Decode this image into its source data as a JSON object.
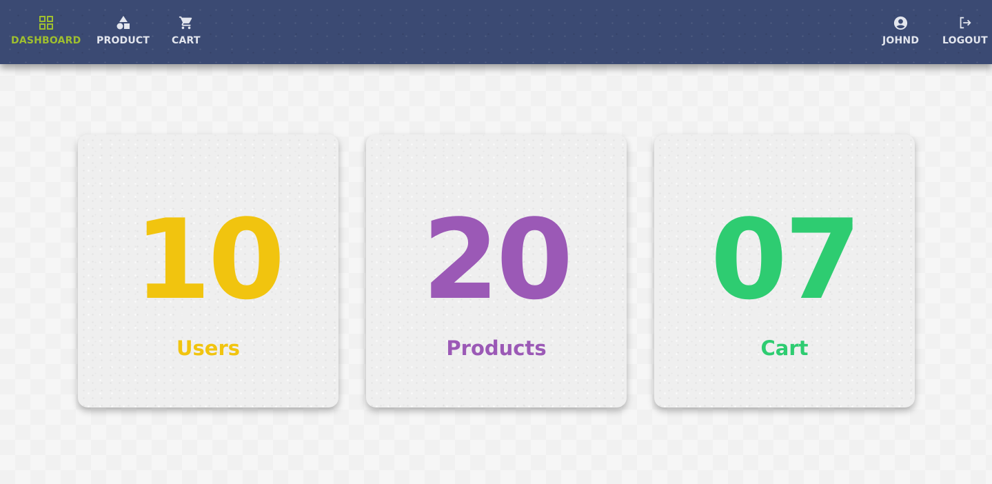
{
  "nav": {
    "left": [
      {
        "label": "DASHBOARD",
        "icon": "dashboard-grid-icon",
        "active": true
      },
      {
        "label": "PRODUCT",
        "icon": "shapes-icon",
        "active": false
      },
      {
        "label": "CART",
        "icon": "shopping-cart-icon",
        "active": false
      }
    ],
    "right": [
      {
        "label": "JOHND",
        "icon": "account-circle-icon"
      },
      {
        "label": "LOGOUT",
        "icon": "logout-icon"
      }
    ]
  },
  "cards": [
    {
      "count": "10",
      "label": "Users",
      "color": "#f1c40f"
    },
    {
      "count": "20",
      "label": "Products",
      "color": "#9b59b6"
    },
    {
      "count": "07",
      "label": "Cart",
      "color": "#2ecc71"
    }
  ],
  "theme": {
    "navbar": "#3b4a73",
    "nav_text": "#e3e6ee",
    "nav_active": "#9fbf2f"
  }
}
